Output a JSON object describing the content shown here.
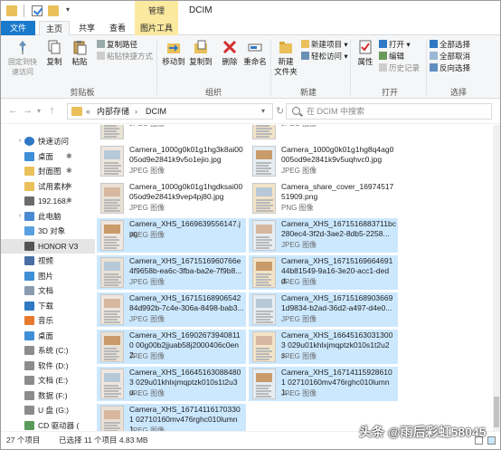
{
  "titlebar": {
    "context_tab": "管理",
    "title": "DCIM"
  },
  "tabs": [
    "文件",
    "主页",
    "共享",
    "查看",
    "图片工具"
  ],
  "ribbon": {
    "clipboard": {
      "pin": "固定到快\n速访问",
      "copy": "复制",
      "paste": "粘贴",
      "copy_path": "复制路径",
      "paste_shortcut": "粘贴快捷方式",
      "label": "剪贴板"
    },
    "organize": {
      "move_to": "移动到",
      "copy_to": "复制到",
      "delete": "删除",
      "rename": "重命名",
      "label": "组织"
    },
    "new": {
      "new_folder": "新建\n文件夹",
      "new_item": "新建项目 ▾",
      "easy_access": "轻松访问 ▾",
      "label": "新建"
    },
    "open": {
      "properties": "属性",
      "open": "打开 ▾",
      "edit": "编辑",
      "history": "历史记录",
      "label": "打开"
    },
    "select": {
      "select_all": "全部选择",
      "select_none": "全部取消",
      "invert": "反向选择",
      "label": "选择"
    }
  },
  "navbar": {
    "path_prefix": "«",
    "path_root": "内部存储",
    "path_sep": "›",
    "path_leaf": "DCIM",
    "search_placeholder": "在 DCIM 中搜索"
  },
  "sidebar": [
    {
      "label": "快速访问",
      "icon": "star-icon",
      "type": "header"
    },
    {
      "label": "桌面",
      "icon": "desktop-folder-icon",
      "pinned": true
    },
    {
      "label": "封面图",
      "icon": "folder-icon",
      "pinned": true
    },
    {
      "label": "试用素材",
      "icon": "folder-icon",
      "pinned": true
    },
    {
      "label": "192.168.",
      "icon": "network-drive-icon",
      "pinned": true
    },
    {
      "label": "此电脑",
      "icon": "computer-icon",
      "type": "header"
    },
    {
      "label": "3D 对象",
      "icon": "3d-objects-icon"
    },
    {
      "label": "HONOR V3",
      "icon": "phone-icon",
      "selected": true
    },
    {
      "label": "视频",
      "icon": "video-icon"
    },
    {
      "label": "图片",
      "icon": "pictures-icon"
    },
    {
      "label": "文档",
      "icon": "documents-icon"
    },
    {
      "label": "下载",
      "icon": "download-icon"
    },
    {
      "label": "音乐",
      "icon": "music-icon"
    },
    {
      "label": "桌面",
      "icon": "desktop-folder-icon"
    },
    {
      "label": "系统 (C:)",
      "icon": "drive-icon"
    },
    {
      "label": "软件 (D:)",
      "icon": "drive-icon"
    },
    {
      "label": "文档 (E:)",
      "icon": "drive-icon"
    },
    {
      "label": "数据 (F:)",
      "icon": "drive-icon"
    },
    {
      "label": "U 盘 (G:)",
      "icon": "usb-drive-icon"
    },
    {
      "label": "CD 驱动器 (",
      "icon": "cd-drive-icon"
    }
  ],
  "files": [
    {
      "name": "...",
      "type": "JPEG 图像",
      "selected": false,
      "col": 0
    },
    {
      "name": "...",
      "type": "JPEG 图像",
      "selected": false,
      "col": 1
    },
    {
      "name": "Camera_1000g0k01g1hg3k8ai0005od9e2841k9v5o1ejio.jpg",
      "type": "JPEG 图像",
      "selected": false,
      "col": 0
    },
    {
      "name": "Camera_1000g0k01g1hg8q4ag0005od9e2841k9v5uqhvc0.jpg",
      "type": "JPEG 图像",
      "selected": false,
      "col": 1
    },
    {
      "name": "Camera_1000g0k01g1hgdksai0005od9e2841k9vep4pj80.jpg",
      "type": "JPEG 图像",
      "selected": false,
      "col": 0
    },
    {
      "name": "Camera_share_cover_1697451751909.png",
      "type": "PNG 图像",
      "selected": false,
      "col": 1
    },
    {
      "name": "Camera_XHS_1669639556147.jpg",
      "type": "JPEG 图像",
      "selected": true,
      "col": 0
    },
    {
      "name": "Camera_XHS_1671516883711bc280ec4-3f2d-3ae2-8db5-2258...",
      "type": "JPEG 图像",
      "selected": true,
      "col": 1
    },
    {
      "name": "Camera_XHS_1671516960766e4f9658b-ea6c-3fba-ba2e-7f9b8...",
      "type": "JPEG 图像",
      "selected": true,
      "col": 0
    },
    {
      "name": "Camera_XHS_1671516966469144b81549-9a16-3e20-acc1-dedd...",
      "type": "JPEG 图像",
      "selected": true,
      "col": 1
    },
    {
      "name": "Camera_XHS_16715168906542 84d992b-7c4e-306a-8498-bab3...",
      "type": "JPEG 图像",
      "selected": true,
      "col": 0
    },
    {
      "name": "Camera_XHS_16715168903669 1d9834-b2ad-36d2-a497-d4e0...",
      "type": "JPEG 图像",
      "selected": true,
      "col": 1
    },
    {
      "name": "Camera_XHS_169026739408110 00g00b2jjuab58j2000406c0en2...",
      "type": "JPEG 图像",
      "selected": true,
      "col": 0
    },
    {
      "name": "Camera_XHS_166451630313003 029u01khlxjmqptzk010s1t2u2s...",
      "type": "JPEG 图像",
      "selected": true,
      "col": 1
    },
    {
      "name": "Camera_XHS_166451630884803 029u01khlxjmqptzk010s1t2u3u...",
      "type": "JPEG 图像",
      "selected": true,
      "col": 0
    },
    {
      "name": "Camera_XHS_167141159286101 02710160mv476rghc010lumn1...",
      "type": "JPEG 图像",
      "selected": true,
      "col": 1
    },
    {
      "name": "Camera_XHS_167141161703301 02710160mv476rghc010lumn1...",
      "type": "JPEG 图像",
      "selected": true,
      "col": 0
    }
  ],
  "status": {
    "count": "27 个项目",
    "selected": "已选择 11 个项目 4.83 MB"
  },
  "watermark": "头条 @雨后彩虹58045"
}
